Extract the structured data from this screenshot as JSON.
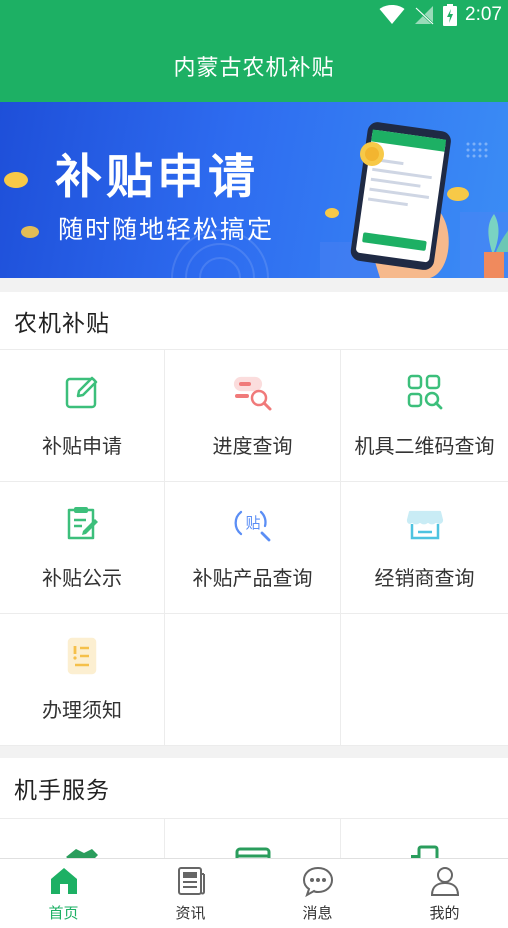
{
  "status_bar": {
    "time": "2:07"
  },
  "app_bar": {
    "title": "内蒙古农机补贴"
  },
  "banner": {
    "title": "补贴申请",
    "subtitle": "随时随地轻松搞定"
  },
  "subsidy_section": {
    "title": "农机补贴",
    "items": [
      {
        "label": "补贴申请",
        "icon": "edit-icon"
      },
      {
        "label": "进度查询",
        "icon": "progress-search-icon"
      },
      {
        "label": "机具二维码查询",
        "icon": "qr-code-search-icon"
      },
      {
        "label": "补贴公示",
        "icon": "clipboard-edit-icon"
      },
      {
        "label": "补贴产品查询",
        "icon": "subsidy-product-search-icon"
      },
      {
        "label": "经销商查询",
        "icon": "store-icon"
      },
      {
        "label": "办理须知",
        "icon": "notice-document-icon"
      }
    ]
  },
  "operator_section": {
    "title": "机手服务"
  },
  "tab_bar": {
    "tabs": [
      {
        "label": "首页",
        "icon": "home-icon",
        "active": true
      },
      {
        "label": "资讯",
        "icon": "news-icon",
        "active": false
      },
      {
        "label": "消息",
        "icon": "message-icon",
        "active": false
      },
      {
        "label": "我的",
        "icon": "profile-icon",
        "active": false
      }
    ]
  },
  "colors": {
    "primary": "#1db064",
    "banner_blue": "#2e6cf0",
    "icon_green": "#3cbf7b",
    "icon_red": "#f07a7a",
    "icon_blue": "#5b8ef5",
    "icon_cyan": "#4ec3e0",
    "icon_yellow": "#f5c04a"
  }
}
